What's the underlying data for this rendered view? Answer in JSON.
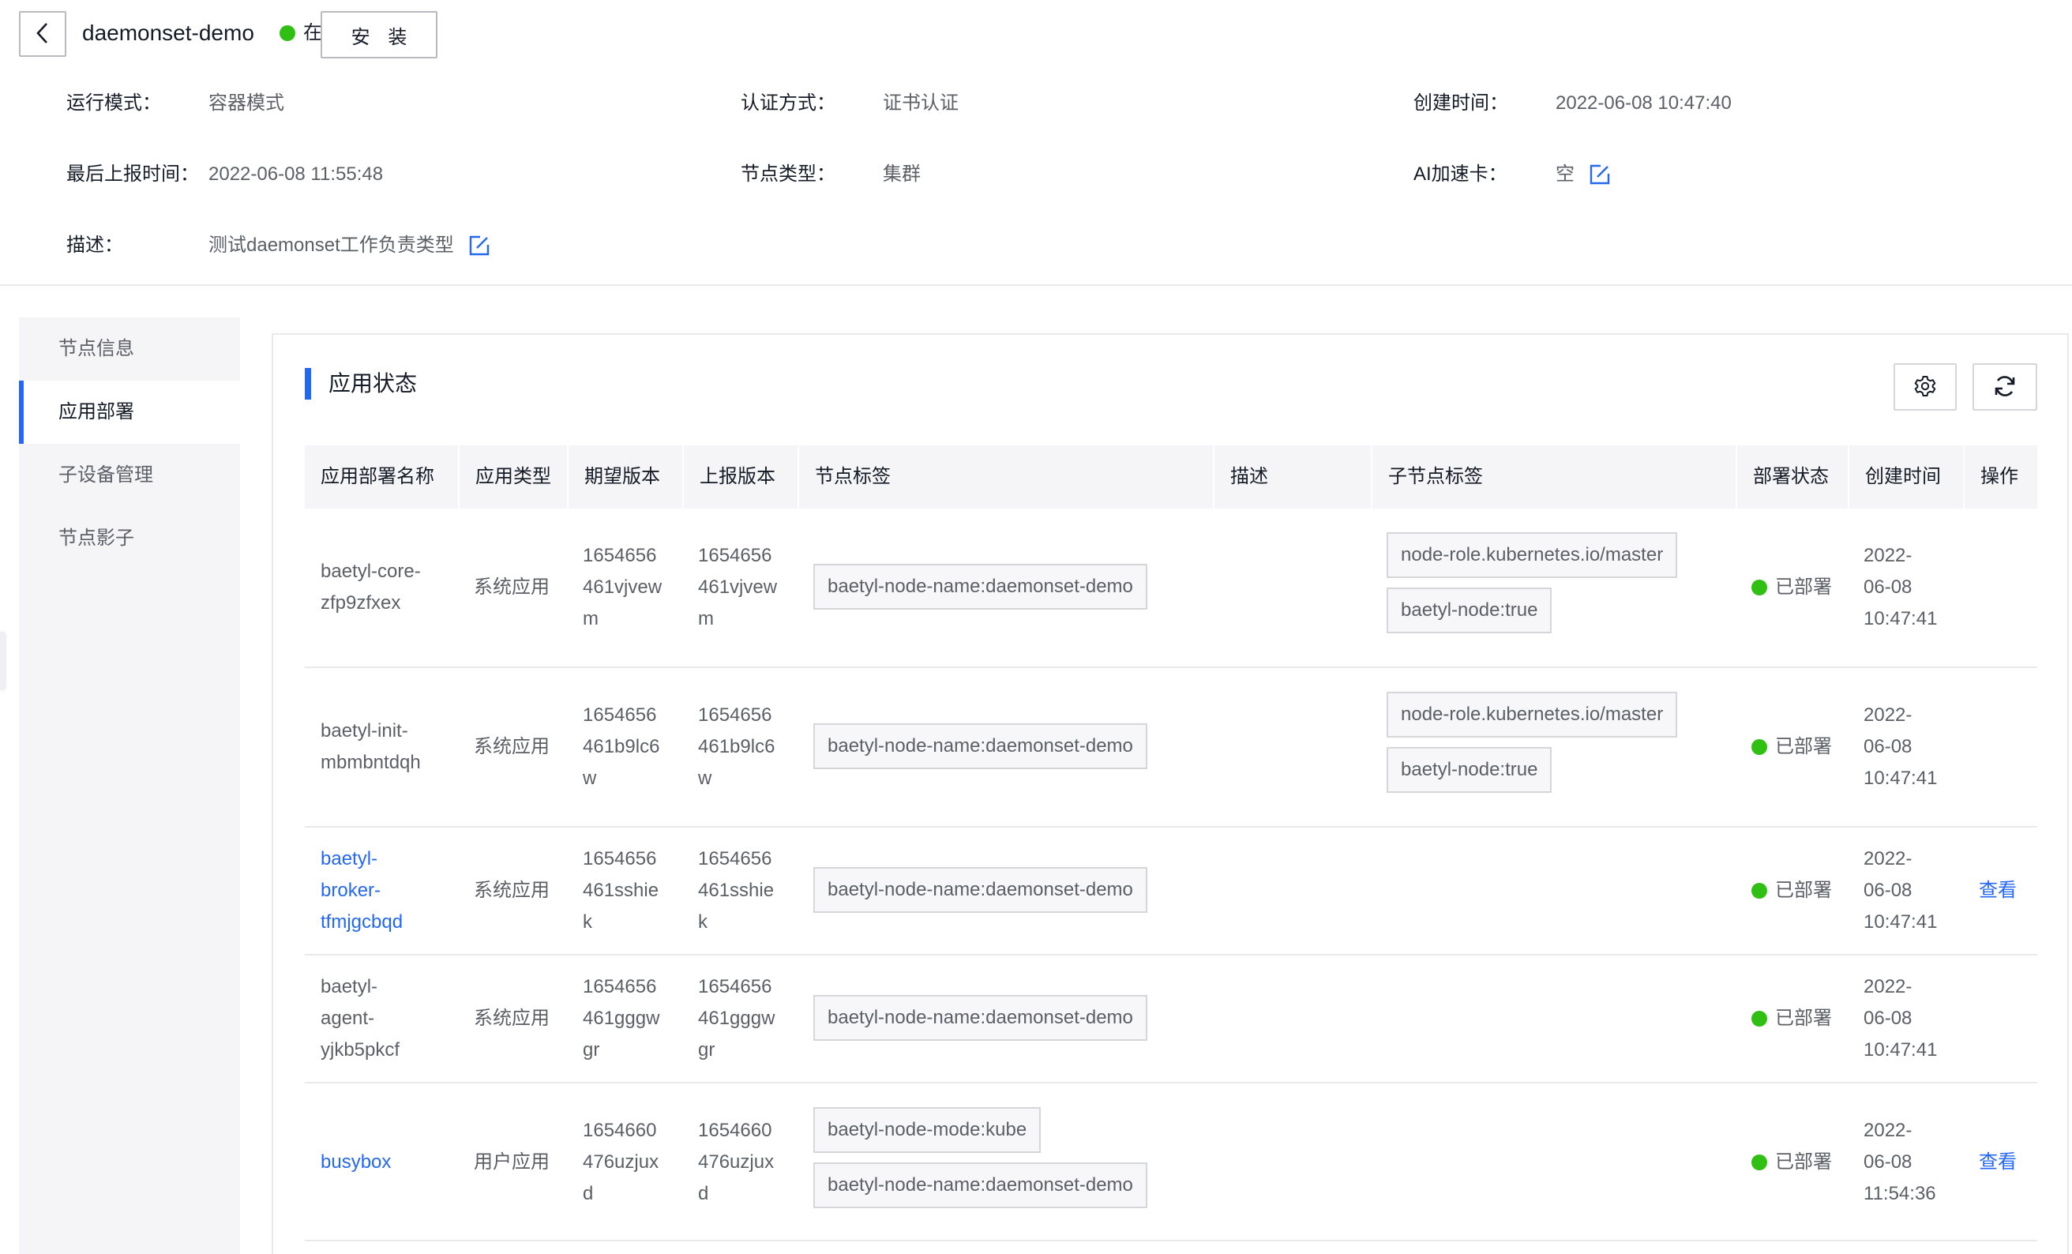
{
  "header": {
    "node_name": "daemonset-demo",
    "status": "在线",
    "install_label": "安 装",
    "fields": {
      "run_mode_label": "运行模式：",
      "run_mode_value": "容器模式",
      "auth_label": "认证方式：",
      "auth_value": "证书认证",
      "created_label": "创建时间：",
      "created_value": "2022-06-08 10:47:40",
      "last_report_label": "最后上报时间：",
      "last_report_value": "2022-06-08 11:55:48",
      "node_type_label": "节点类型：",
      "node_type_value": "集群",
      "ai_label": "AI加速卡：",
      "ai_value": "空",
      "desc_label": "描述：",
      "desc_value": "测试daemonset工作负责类型"
    }
  },
  "sidebar": {
    "items": [
      {
        "label": "节点信息"
      },
      {
        "label": "应用部署"
      },
      {
        "label": "子设备管理"
      },
      {
        "label": "节点影子"
      }
    ]
  },
  "panel": {
    "title": "应用状态"
  },
  "table": {
    "headers": {
      "name": "应用部署名称",
      "type": "应用类型",
      "expected": "期望版本",
      "reported": "上报版本",
      "node_labels": "节点标签",
      "desc": "描述",
      "sub_labels": "子节点标签",
      "deploy_status": "部署状态",
      "created": "创建时间",
      "ops": "操作"
    },
    "rows": [
      {
        "name1": "baetyl-core-",
        "name2": "zfp9zfxex",
        "name3": "",
        "type": "系统应用",
        "exp1": "1654656",
        "exp2": "461vjvew",
        "exp3": "m",
        "rep1": "1654656",
        "rep2": "461vjvew",
        "rep3": "m",
        "node_tag1": "baetyl-node-name:daemonset-demo",
        "sub_tag1": "node-role.kubernetes.io/master",
        "sub_tag2": "baetyl-node:true",
        "status": "已部署",
        "c1": "2022-",
        "c2": "06-08",
        "c3": "10:47:41",
        "op": ""
      },
      {
        "name1": "baetyl-init-",
        "name2": "mbmbntdqh",
        "name3": "",
        "type": "系统应用",
        "exp1": "1654656",
        "exp2": "461b9lc6",
        "exp3": "w",
        "rep1": "1654656",
        "rep2": "461b9lc6",
        "rep3": "w",
        "node_tag1": "baetyl-node-name:daemonset-demo",
        "sub_tag1": "node-role.kubernetes.io/master",
        "sub_tag2": "baetyl-node:true",
        "status": "已部署",
        "c1": "2022-",
        "c2": "06-08",
        "c3": "10:47:41",
        "op": ""
      },
      {
        "name1": "baetyl-",
        "name2": "broker-",
        "name3": "tfmjgcbqd",
        "type": "系统应用",
        "exp1": "1654656",
        "exp2": "461sshie",
        "exp3": "k",
        "rep1": "1654656",
        "rep2": "461sshie",
        "rep3": "k",
        "node_tag1": "baetyl-node-name:daemonset-demo",
        "status": "已部署",
        "c1": "2022-",
        "c2": "06-08",
        "c3": "10:47:41",
        "op": "查看"
      },
      {
        "name1": "baetyl-",
        "name2": "agent-",
        "name3": "yjkb5pkcf",
        "type": "系统应用",
        "exp1": "1654656",
        "exp2": "461gggw",
        "exp3": "gr",
        "rep1": "1654656",
        "rep2": "461gggw",
        "rep3": "gr",
        "node_tag1": "baetyl-node-name:daemonset-demo",
        "status": "已部署",
        "c1": "2022-",
        "c2": "06-08",
        "c3": "10:47:41",
        "op": ""
      },
      {
        "name1": "busybox",
        "type": "用户应用",
        "exp1": "1654660",
        "exp2": "476uzjux",
        "exp3": "d",
        "rep1": "1654660",
        "rep2": "476uzjux",
        "rep3": "d",
        "node_tag1": "baetyl-node-mode:kube",
        "node_tag2": "baetyl-node-name:daemonset-demo",
        "status": "已部署",
        "c1": "2022-",
        "c2": "06-08",
        "c3": "11:54:36",
        "op": "查看"
      }
    ]
  },
  "colors": {
    "accent": "#2468f2",
    "online": "#30bf13",
    "border": "#e8e9eb",
    "header_bg": "#f5f5f7"
  },
  "icons": {
    "back": "chevron-left-icon",
    "edit": "edit-icon",
    "settings": "gear-icon",
    "refresh": "refresh-icon"
  }
}
